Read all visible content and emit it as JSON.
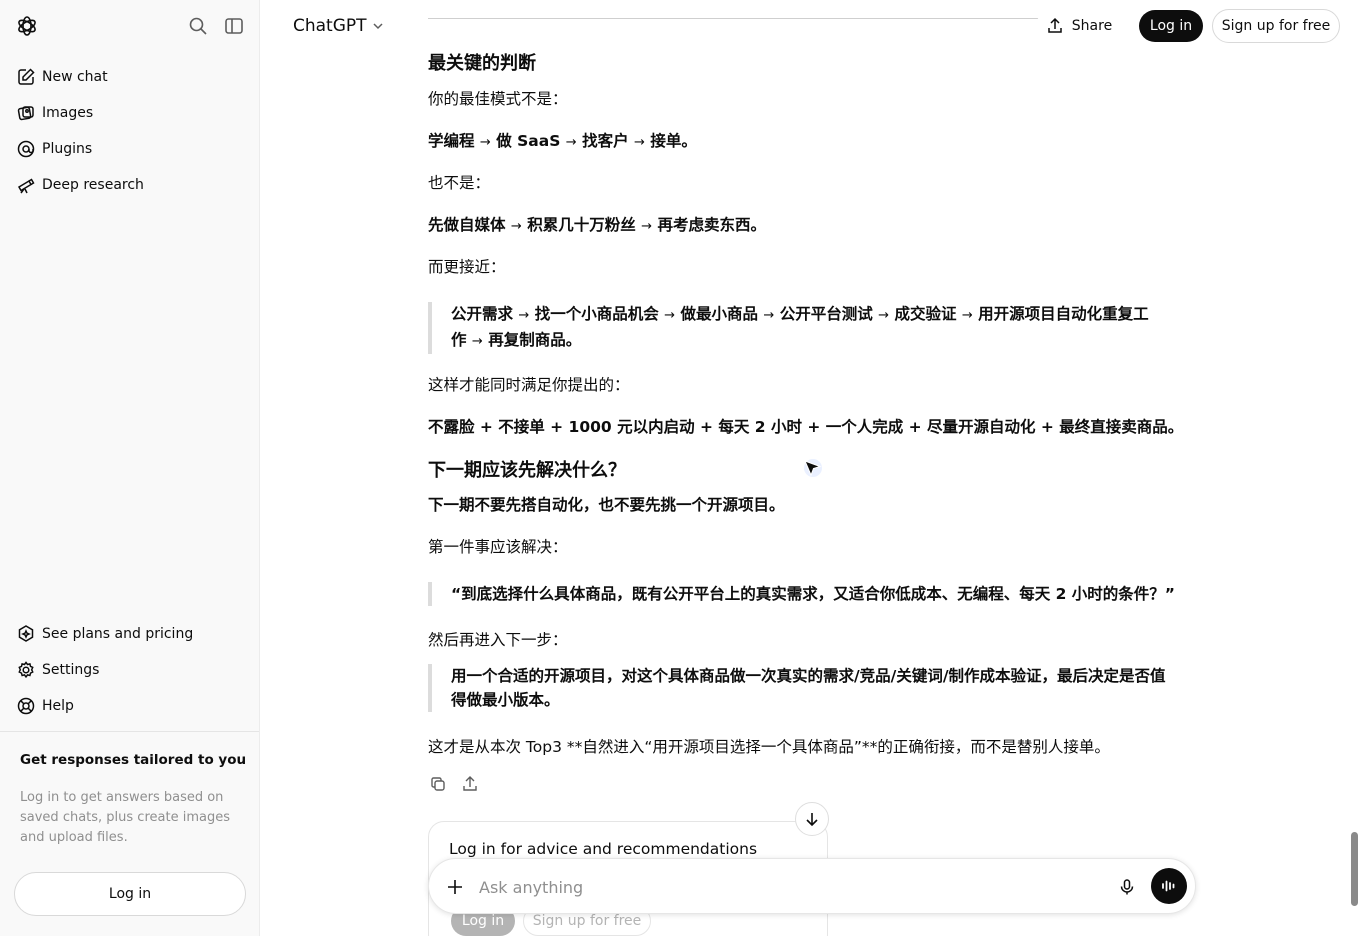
{
  "app": {
    "name": "ChatGPT"
  },
  "sidebar": {
    "items": [
      {
        "label": "New chat",
        "icon": "edit-icon"
      },
      {
        "label": "Images",
        "icon": "images-icon"
      },
      {
        "label": "Plugins",
        "icon": "plugins-icon"
      },
      {
        "label": "Deep research",
        "icon": "telescope-icon"
      }
    ],
    "bottom_items": [
      {
        "label": "See plans and pricing",
        "icon": "sparkle-icon"
      },
      {
        "label": "Settings",
        "icon": "gear-icon"
      },
      {
        "label": "Help",
        "icon": "help-icon"
      }
    ],
    "promo": {
      "title": "Get responses tailored to you",
      "text": "Log in to get answers based on saved chats, plus create images and upload files."
    },
    "login_label": "Log in"
  },
  "header": {
    "model": "ChatGPT",
    "share_label": "Share",
    "login_label": "Log in",
    "signup_label": "Sign up for free"
  },
  "message": {
    "h1": "最关键的判断",
    "p1": "你的最佳模式不是：",
    "flow1": [
      "学编程",
      "做 SaaS",
      "找客户",
      "接单。"
    ],
    "p2": "也不是：",
    "flow2": [
      "先做自媒体",
      "积累几十万粉丝",
      "再考虑卖东西。"
    ],
    "p3": "而更接近：",
    "quote1_line1": [
      "公开需求",
      "找一个小商品机会",
      "做最小商品",
      "公开平台测试",
      "成交验证",
      "用开源项目自动化重复工"
    ],
    "quote1_line2": [
      "作",
      "再复制商品。"
    ],
    "p4": "这样才能同时满足你提出的：",
    "summary": "不露脸 + 不接单 + 1000 元以内启动 + 每天 2 小时 + 一个人完成 + 尽量开源自动化 + 最终直接卖商品。",
    "h2": "下一期应该先解决什么？",
    "p5": "下一期不要先搭自动化，也不要先挑一个开源项目。",
    "p6": "第一件事应该解决：",
    "quote2": "“到底选择什么具体商品，既有公开平台上的真实需求，又适合你低成本、无编程、每天 2 小时的条件？”",
    "p7": "然后再进入下一步：",
    "quote3_line1": "用一个合适的开源项目，对这个具体商品做一次真实的需求/竞品/关键词/制作成本验证，最后决定是否值",
    "quote3_line2": "得做最小版本。",
    "p8": "这才是从本次 Top3 **自然进入“用开源项目选择一个具体商品”**的正确衔接，而不是替别人接单。"
  },
  "login_card": {
    "title": "Log in for advice and recommendations",
    "login_label": "Log in",
    "signup_label": "Sign up for free"
  },
  "composer": {
    "placeholder": "Ask anything"
  },
  "arrow_glyph": "→"
}
